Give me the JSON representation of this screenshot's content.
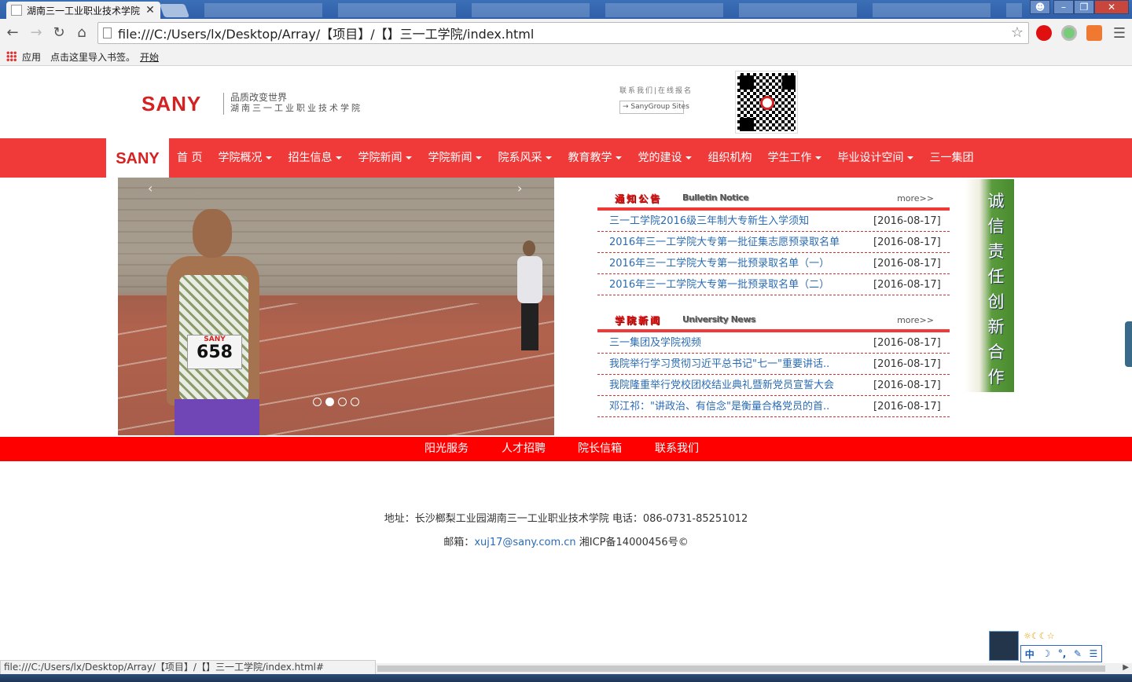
{
  "browser": {
    "tab_title": "湖南三一工业职业技术学院",
    "tab_close": "✕",
    "url": "file:///C:/Users/lx/Desktop/Array/【项目】/【】三一工学院/index.html",
    "bookmarks": [
      "应用",
      "点击这里导入书签。",
      "开始"
    ],
    "status_url": "file:///C:/Users/lx/Desktop/Array/【项目】/【】三一工学院/index.html#"
  },
  "header": {
    "logo": "SANY",
    "slogan1": "品质改变世界",
    "slogan2": "湖南三一工业职业技术学院",
    "contact_links": "联系我们|在线报名",
    "group_sites": "→ SanyGroup Sites"
  },
  "nav": {
    "logo": "SANY",
    "items": [
      {
        "label": "首 页",
        "caret": false
      },
      {
        "label": "学院概况",
        "caret": true
      },
      {
        "label": "招生信息",
        "caret": true
      },
      {
        "label": "学院新闻",
        "caret": true
      },
      {
        "label": "学院新闻",
        "caret": true
      },
      {
        "label": "院系风采",
        "caret": true
      },
      {
        "label": "教育教学",
        "caret": true
      },
      {
        "label": "党的建设",
        "caret": true
      },
      {
        "label": "组织机构",
        "caret": false
      },
      {
        "label": "学生工作",
        "caret": true
      },
      {
        "label": "毕业设计空间",
        "caret": true
      },
      {
        "label": "三一集团",
        "caret": false
      }
    ]
  },
  "slider": {
    "prev": "‹",
    "next": "›",
    "bib_brand": "SANY",
    "bib_number": "658",
    "active_slide": 2,
    "slide_count": 4
  },
  "notice": {
    "title_cn": "通知公告",
    "title_en": "Bulletin Notice",
    "more": "more>>",
    "items": [
      {
        "title": "三一工学院2016级三年制大专新生入学须知",
        "date": "[2016-08-17]"
      },
      {
        "title": "2016年三一工学院大专第一批征集志愿预录取名单",
        "date": "[2016-08-17]"
      },
      {
        "title": "2016年三一工学院大专第一批预录取名单（一）",
        "date": "[2016-08-17]"
      },
      {
        "title": "2016年三一工学院大专第一批预录取名单（二）",
        "date": "[2016-08-17]"
      }
    ]
  },
  "news": {
    "title_cn": "学院新闻",
    "title_en": "University News",
    "more": "more>>",
    "items": [
      {
        "title": "三一集团及学院视频",
        "date": "[2016-08-17]"
      },
      {
        "title": "我院举行学习贯彻习近平总书记\"七一\"重要讲话..",
        "date": "[2016-08-17]"
      },
      {
        "title": "我院隆重举行党校团校结业典礼暨新党员宣誓大会",
        "date": "[2016-08-17]"
      },
      {
        "title": "邓江祁：\"讲政治、有信念\"是衡量合格党员的首..",
        "date": "[2016-08-17]"
      }
    ]
  },
  "side_banner": {
    "text": "诚信 责任 创新 合作"
  },
  "footer_nav": [
    "阳光服务",
    "人才招聘",
    "院长信箱",
    "联系我们"
  ],
  "footer": {
    "address": "地址：长沙榔梨工业园湖南三一工业职业技术学院 电话：086-0731-85251012",
    "mail_label": "邮箱：",
    "mail": "xuj17@sany.com.cn",
    "icp": " 湘ICP备14000456号©"
  },
  "ime": {
    "top": "☼☾☾☆",
    "chars": [
      "中",
      "☽",
      "°,",
      "✎",
      "☰"
    ]
  }
}
